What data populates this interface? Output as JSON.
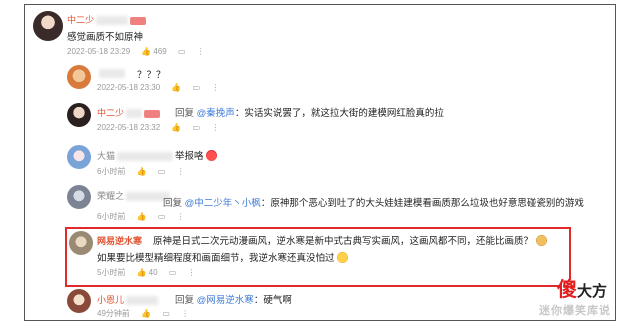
{
  "comments": [
    {
      "name_visible": "中二少",
      "text": "感觉画质不如原神",
      "date": "2022-05-18 23:29",
      "likes": "469"
    },
    {
      "name_visible": "",
      "text": "？？？",
      "date": "2022-05-18 23:30"
    },
    {
      "name_visible": "中二少",
      "reply_label": "回复",
      "mention": "@秦挽声",
      "text": "：实话实说罢了，就这拉大街的建模网红脸真的拉",
      "date": "2022-05-18 23:32"
    },
    {
      "name_visible": "大猫",
      "text": "举报咯",
      "date": "6小时前"
    },
    {
      "name_visible": "荣耀之",
      "reply_label": "回复",
      "mention": "@中二少年丶小枫",
      "text": "：原神那个恶心到吐了的大头娃娃建模",
      "text_tail": "看画质那么垃圾也好意思碰瓷别的游戏",
      "date": "6小时前"
    },
    {
      "name_visible": "网易逆水寒",
      "line1": "原神是日式二次元动漫画风，逆水寒是新中式古典写实画风，这画风都不同，还能比画质？",
      "line2": "如果要比模型精细程度和画面细节，我逆水寒还真没怕过",
      "date": "5小时前",
      "likes": "40"
    },
    {
      "name_visible": "小恩儿",
      "reply_label": "回复",
      "mention": "@网易逆水寒",
      "text": "：硬气啊",
      "date": "49分钟前"
    }
  ],
  "watermark": {
    "brand_red": "傻",
    "brand_rest": "大方",
    "sub": "迷你爆笑库说"
  },
  "colors": {
    "accent": "#e0502e",
    "mention": "#3d7bd8",
    "highlight": "#e12a2a"
  }
}
